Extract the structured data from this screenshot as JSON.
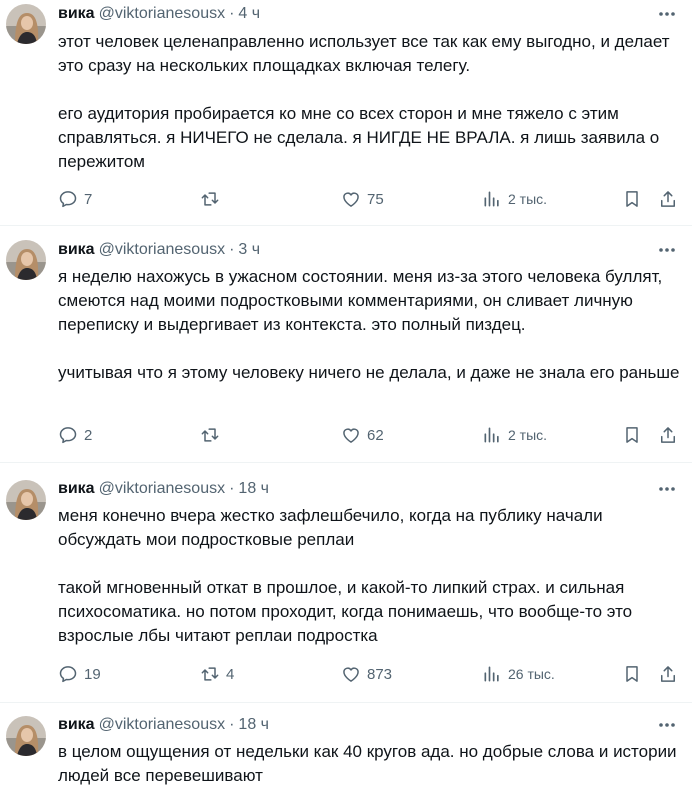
{
  "tweets": [
    {
      "name": "вика",
      "handle": "@viktorianesousx",
      "separator": "·",
      "time": "4 ч",
      "text": "этот человек целенаправленно использует все так как ему выгодно, и делает это сразу на нескольких площадках включая телегу.\n\nего аудитория пробирается ко мне со всех сторон и мне тяжело с этим справляться. я НИЧЕГО не сделала. я НИГДЕ НЕ ВРАЛА. я лишь заявила о пережитом",
      "replies": "7",
      "retweets": "",
      "likes": "75",
      "views": "2 тыс."
    },
    {
      "name": "вика",
      "handle": "@viktorianesousx",
      "separator": "·",
      "time": "3 ч",
      "text": "я неделю нахожусь в ужасном состоянии. меня из-за этого человека буллят, смеются над моими подростковыми комментариями, он сливает личную переписку и выдергивает из контекста. это полный пиздец.\n\nучитывая что я этому человеку ничего не делала, и даже не знала его раньше",
      "replies": "2",
      "retweets": "",
      "likes": "62",
      "views": "2 тыс."
    },
    {
      "name": "вика",
      "handle": "@viktorianesousx",
      "separator": "·",
      "time": "18 ч",
      "text": "меня конечно вчера жестко зафлешбечило, когда на публику начали обсуждать мои подростковые реплаи\n\nтакой мгновенный откат в прошлое, и какой-то липкий страх. и сильная психосоматика. но потом проходит, когда понимаешь, что вообще-то это взрослые лбы читают реплаи подростка",
      "replies": "19",
      "retweets": "4",
      "likes": "873",
      "views": "26 тыс."
    },
    {
      "name": "вика",
      "handle": "@viktorianesousx",
      "separator": "·",
      "time": "18 ч",
      "text": "в целом ощущения от недельки как 40 кругов ада. но добрые слова и истории людей все перевешивают"
    }
  ],
  "icons": {
    "reply": "reply-icon",
    "retweet": "retweet-icon",
    "like": "heart-icon",
    "views": "views-chart-icon",
    "bookmark": "bookmark-icon",
    "share": "share-icon",
    "more": "more-dots-icon"
  },
  "colors": {
    "text": "#0f1419",
    "secondary": "#536471",
    "divider": "#eff3f4"
  }
}
